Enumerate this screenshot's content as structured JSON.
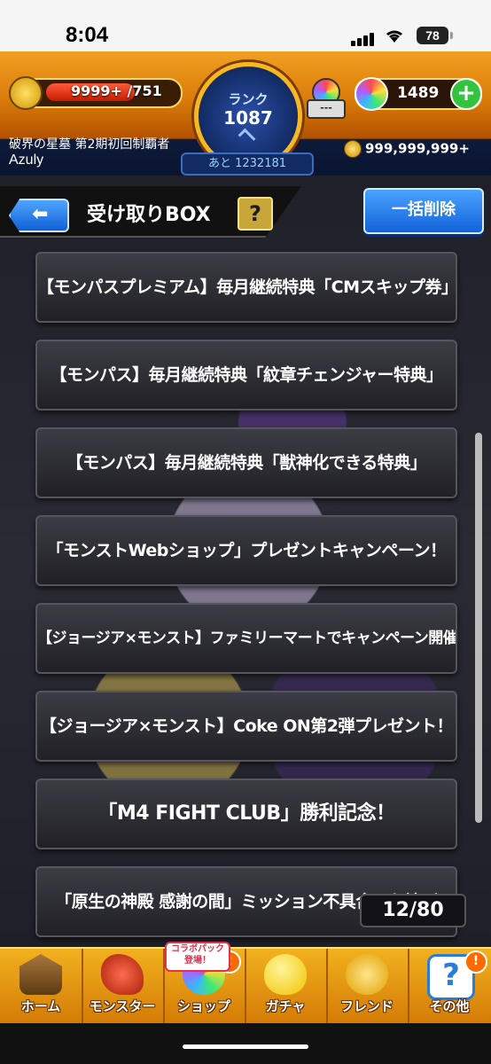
{
  "status_bar": {
    "time": "8:04",
    "battery": "78"
  },
  "header": {
    "stamina": "9999+ /751",
    "rank_label": "ランク",
    "rank_value": "1087",
    "next_rank": "あと 1232181",
    "orb_slot": "---",
    "orb_count": "1489",
    "quest_title": "破界の星墓 第2期初回制覇者",
    "user_name": "Azuly",
    "gold": "999,999,999+"
  },
  "toolbar": {
    "title": "受け取りBOX",
    "help": "?",
    "delete_all": "一括削除"
  },
  "messages": [
    "【モンパスプレミアム】毎月継続特典「CMスキップ券」",
    "【モンパス】毎月継続特典「紋章チェンジャー特典」",
    "【モンパス】毎月継続特典「獣神化できる特典」",
    "「モンストWebショップ」プレゼントキャンペーン！",
    "【ジョージア×モンスト】ファミリーマートでキャンペーン開催！",
    "【ジョージア×モンスト】Coke ON第2弾プレゼント！",
    "「M4 FIGHT CLUB」勝利記念！",
    "「原生の神殿 感謝の間」ミッション不具合のお詫び"
  ],
  "counter": "12/80",
  "nav": {
    "collab_badge": "コラボパック 登場！",
    "items": [
      {
        "label": "ホーム",
        "icon": "castle-icon"
      },
      {
        "label": "モンスター",
        "icon": "dragon-icon"
      },
      {
        "label": "ショップ",
        "icon": "orb-icon"
      },
      {
        "label": "ガチャ",
        "icon": "egg-icon"
      },
      {
        "label": "フレンド",
        "icon": "friends-icon"
      },
      {
        "label": "その他",
        "icon": "question-icon"
      }
    ]
  }
}
